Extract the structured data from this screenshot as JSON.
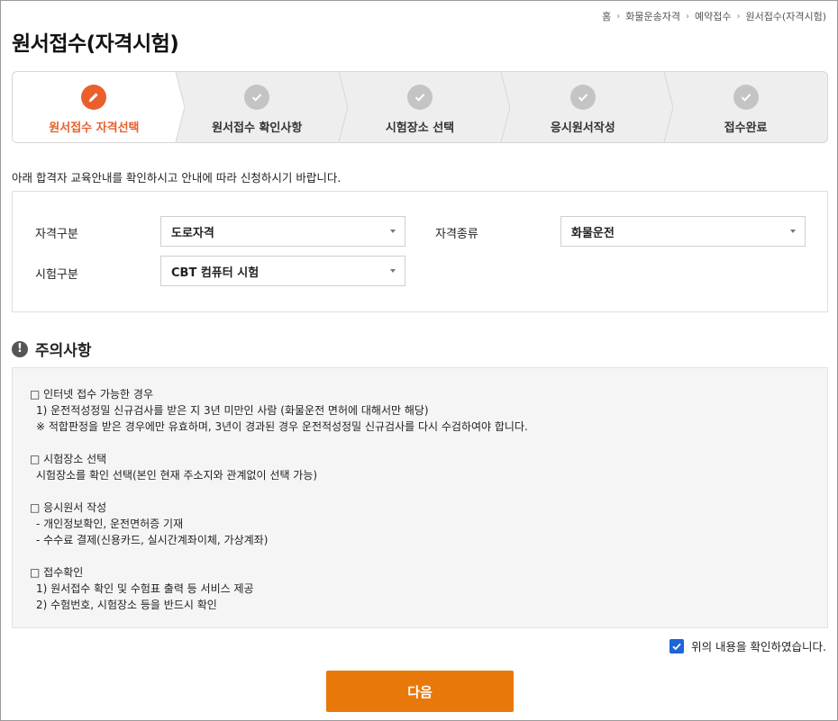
{
  "breadcrumb": [
    "홈",
    "화물운송자격",
    "예약접수",
    "원서접수(자격시험)"
  ],
  "page_title": "원서접수(자격시험)",
  "steps": [
    {
      "label": "원서접수 자격선택",
      "icon": "pencil-icon",
      "active": true
    },
    {
      "label": "원서접수 확인사항",
      "icon": "check-icon",
      "active": false
    },
    {
      "label": "시험장소 선택",
      "icon": "check-icon",
      "active": false
    },
    {
      "label": "응시원서작성",
      "icon": "check-icon",
      "active": false
    },
    {
      "label": "접수완료",
      "icon": "check-icon",
      "active": false
    }
  ],
  "intro_text": "아래 합격자 교육안내를 확인하시고 안내에 따라 신청하시기 바랍니다.",
  "form": {
    "qualification_type_label": "자격구분",
    "qualification_type_value": "도로자격",
    "qualification_kind_label": "자격종류",
    "qualification_kind_value": "화물운전",
    "exam_type_label": "시험구분",
    "exam_type_value": "CBT 컴퓨터 시험"
  },
  "notice": {
    "title": "주의사항",
    "sections": [
      {
        "heading": "□ 인터넷 접수 가능한 경우",
        "lines": [
          "1) 운전적성정밀 신규검사를 받은 지 3년 미만인 사람 (화물운전 면허에 대해서만 해당)",
          "※ 적합판정을 받은 경우에만 유효하며, 3년이 경과된 경우 운전적성정밀 신규검사를 다시 수검하여야 합니다."
        ]
      },
      {
        "heading": "□ 시험장소 선택",
        "lines": [
          "시험장소를 확인 선택(본인 현재 주소지와 관계없이 선택 가능)"
        ]
      },
      {
        "heading": "□ 응시원서 작성",
        "lines": [
          "- 개인정보확인, 운전면허증 기재",
          "- 수수료 결제(신용카드, 실시간계좌이체, 가상계좌)"
        ]
      },
      {
        "heading": "□ 접수확인",
        "lines": [
          "1) 원서접수 확인 및 수험표 출력 등 서비스 제공",
          "2) 수험번호, 시험장소 등을 반드시 확인"
        ]
      }
    ]
  },
  "agree_label": "위의 내용을 확인하였습니다.",
  "agree_checked": true,
  "next_button": "다음",
  "colors": {
    "accent": "#e9602c",
    "button": "#e9780a",
    "checkbox": "#1f64d8"
  }
}
